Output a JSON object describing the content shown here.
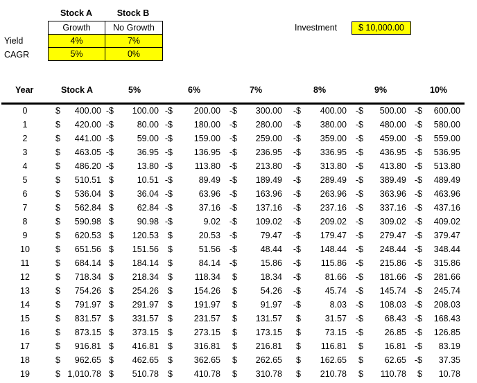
{
  "summary": {
    "stock_a_label": "Stock A",
    "stock_b_label": "Stock B",
    "stock_a_type": "Growth",
    "stock_b_type": "No Growth",
    "yield_label": "Yield",
    "cagr_label": "CAGR",
    "stock_a_yield": "4%",
    "stock_b_yield": "7%",
    "stock_a_cagr": "5%",
    "stock_b_cagr": "0%",
    "highlight_color": "#ffff00"
  },
  "investment": {
    "label": "Investment",
    "value": "$ 10,000.00"
  },
  "table": {
    "headers": [
      "Year",
      "Stock A",
      "5%",
      "6%",
      "7%",
      "8%",
      "9%",
      "10%"
    ],
    "rows": [
      {
        "year": "0",
        "stock_a": [
          "$",
          "400.00"
        ],
        "c5": [
          "-$",
          "100.00"
        ],
        "c6": [
          "-$",
          "200.00"
        ],
        "c7": [
          "-$",
          "300.00"
        ],
        "c8": [
          "-$",
          "400.00"
        ],
        "c9": [
          "-$",
          "500.00"
        ],
        "c10": [
          "-$",
          "600.00"
        ]
      },
      {
        "year": "1",
        "stock_a": [
          "$",
          "420.00"
        ],
        "c5": [
          "-$",
          "80.00"
        ],
        "c6": [
          "-$",
          "180.00"
        ],
        "c7": [
          "-$",
          "280.00"
        ],
        "c8": [
          "-$",
          "380.00"
        ],
        "c9": [
          "-$",
          "480.00"
        ],
        "c10": [
          "-$",
          "580.00"
        ]
      },
      {
        "year": "2",
        "stock_a": [
          "$",
          "441.00"
        ],
        "c5": [
          "-$",
          "59.00"
        ],
        "c6": [
          "-$",
          "159.00"
        ],
        "c7": [
          "-$",
          "259.00"
        ],
        "c8": [
          "-$",
          "359.00"
        ],
        "c9": [
          "-$",
          "459.00"
        ],
        "c10": [
          "-$",
          "559.00"
        ]
      },
      {
        "year": "3",
        "stock_a": [
          "$",
          "463.05"
        ],
        "c5": [
          "-$",
          "36.95"
        ],
        "c6": [
          "-$",
          "136.95"
        ],
        "c7": [
          "-$",
          "236.95"
        ],
        "c8": [
          "-$",
          "336.95"
        ],
        "c9": [
          "-$",
          "436.95"
        ],
        "c10": [
          "-$",
          "536.95"
        ]
      },
      {
        "year": "4",
        "stock_a": [
          "$",
          "486.20"
        ],
        "c5": [
          "-$",
          "13.80"
        ],
        "c6": [
          "-$",
          "113.80"
        ],
        "c7": [
          "-$",
          "213.80"
        ],
        "c8": [
          "-$",
          "313.80"
        ],
        "c9": [
          "-$",
          "413.80"
        ],
        "c10": [
          "-$",
          "513.80"
        ]
      },
      {
        "year": "5",
        "stock_a": [
          "$",
          "510.51"
        ],
        "c5": [
          "$",
          "10.51"
        ],
        "c6": [
          "-$",
          "89.49"
        ],
        "c7": [
          "-$",
          "189.49"
        ],
        "c8": [
          "-$",
          "289.49"
        ],
        "c9": [
          "-$",
          "389.49"
        ],
        "c10": [
          "-$",
          "489.49"
        ]
      },
      {
        "year": "6",
        "stock_a": [
          "$",
          "536.04"
        ],
        "c5": [
          "$",
          "36.04"
        ],
        "c6": [
          "-$",
          "63.96"
        ],
        "c7": [
          "-$",
          "163.96"
        ],
        "c8": [
          "-$",
          "263.96"
        ],
        "c9": [
          "-$",
          "363.96"
        ],
        "c10": [
          "-$",
          "463.96"
        ]
      },
      {
        "year": "7",
        "stock_a": [
          "$",
          "562.84"
        ],
        "c5": [
          "$",
          "62.84"
        ],
        "c6": [
          "-$",
          "37.16"
        ],
        "c7": [
          "-$",
          "137.16"
        ],
        "c8": [
          "-$",
          "237.16"
        ],
        "c9": [
          "-$",
          "337.16"
        ],
        "c10": [
          "-$",
          "437.16"
        ]
      },
      {
        "year": "8",
        "stock_a": [
          "$",
          "590.98"
        ],
        "c5": [
          "$",
          "90.98"
        ],
        "c6": [
          "-$",
          "9.02"
        ],
        "c7": [
          "-$",
          "109.02"
        ],
        "c8": [
          "-$",
          "209.02"
        ],
        "c9": [
          "-$",
          "309.02"
        ],
        "c10": [
          "-$",
          "409.02"
        ]
      },
      {
        "year": "9",
        "stock_a": [
          "$",
          "620.53"
        ],
        "c5": [
          "$",
          "120.53"
        ],
        "c6": [
          "$",
          "20.53"
        ],
        "c7": [
          "-$",
          "79.47"
        ],
        "c8": [
          "-$",
          "179.47"
        ],
        "c9": [
          "-$",
          "279.47"
        ],
        "c10": [
          "-$",
          "379.47"
        ]
      },
      {
        "year": "10",
        "stock_a": [
          "$",
          "651.56"
        ],
        "c5": [
          "$",
          "151.56"
        ],
        "c6": [
          "$",
          "51.56"
        ],
        "c7": [
          "-$",
          "48.44"
        ],
        "c8": [
          "-$",
          "148.44"
        ],
        "c9": [
          "-$",
          "248.44"
        ],
        "c10": [
          "-$",
          "348.44"
        ]
      },
      {
        "year": "11",
        "stock_a": [
          "$",
          "684.14"
        ],
        "c5": [
          "$",
          "184.14"
        ],
        "c6": [
          "$",
          "84.14"
        ],
        "c7": [
          "-$",
          "15.86"
        ],
        "c8": [
          "-$",
          "115.86"
        ],
        "c9": [
          "-$",
          "215.86"
        ],
        "c10": [
          "-$",
          "315.86"
        ]
      },
      {
        "year": "12",
        "stock_a": [
          "$",
          "718.34"
        ],
        "c5": [
          "$",
          "218.34"
        ],
        "c6": [
          "$",
          "118.34"
        ],
        "c7": [
          "$",
          "18.34"
        ],
        "c8": [
          "-$",
          "81.66"
        ],
        "c9": [
          "-$",
          "181.66"
        ],
        "c10": [
          "-$",
          "281.66"
        ]
      },
      {
        "year": "13",
        "stock_a": [
          "$",
          "754.26"
        ],
        "c5": [
          "$",
          "254.26"
        ],
        "c6": [
          "$",
          "154.26"
        ],
        "c7": [
          "$",
          "54.26"
        ],
        "c8": [
          "-$",
          "45.74"
        ],
        "c9": [
          "-$",
          "145.74"
        ],
        "c10": [
          "-$",
          "245.74"
        ]
      },
      {
        "year": "14",
        "stock_a": [
          "$",
          "791.97"
        ],
        "c5": [
          "$",
          "291.97"
        ],
        "c6": [
          "$",
          "191.97"
        ],
        "c7": [
          "$",
          "91.97"
        ],
        "c8": [
          "-$",
          "8.03"
        ],
        "c9": [
          "-$",
          "108.03"
        ],
        "c10": [
          "-$",
          "208.03"
        ]
      },
      {
        "year": "15",
        "stock_a": [
          "$",
          "831.57"
        ],
        "c5": [
          "$",
          "331.57"
        ],
        "c6": [
          "$",
          "231.57"
        ],
        "c7": [
          "$",
          "131.57"
        ],
        "c8": [
          "$",
          "31.57"
        ],
        "c9": [
          "-$",
          "68.43"
        ],
        "c10": [
          "-$",
          "168.43"
        ]
      },
      {
        "year": "16",
        "stock_a": [
          "$",
          "873.15"
        ],
        "c5": [
          "$",
          "373.15"
        ],
        "c6": [
          "$",
          "273.15"
        ],
        "c7": [
          "$",
          "173.15"
        ],
        "c8": [
          "$",
          "73.15"
        ],
        "c9": [
          "-$",
          "26.85"
        ],
        "c10": [
          "-$",
          "126.85"
        ]
      },
      {
        "year": "17",
        "stock_a": [
          "$",
          "916.81"
        ],
        "c5": [
          "$",
          "416.81"
        ],
        "c6": [
          "$",
          "316.81"
        ],
        "c7": [
          "$",
          "216.81"
        ],
        "c8": [
          "$",
          "116.81"
        ],
        "c9": [
          "$",
          "16.81"
        ],
        "c10": [
          "-$",
          "83.19"
        ]
      },
      {
        "year": "18",
        "stock_a": [
          "$",
          "962.65"
        ],
        "c5": [
          "$",
          "462.65"
        ],
        "c6": [
          "$",
          "362.65"
        ],
        "c7": [
          "$",
          "262.65"
        ],
        "c8": [
          "$",
          "162.65"
        ],
        "c9": [
          "$",
          "62.65"
        ],
        "c10": [
          "-$",
          "37.35"
        ]
      },
      {
        "year": "19",
        "stock_a": [
          "$",
          "1,010.78"
        ],
        "c5": [
          "$",
          "510.78"
        ],
        "c6": [
          "$",
          "410.78"
        ],
        "c7": [
          "$",
          "310.78"
        ],
        "c8": [
          "$",
          "210.78"
        ],
        "c9": [
          "$",
          "110.78"
        ],
        "c10": [
          "$",
          "10.78"
        ]
      }
    ]
  }
}
